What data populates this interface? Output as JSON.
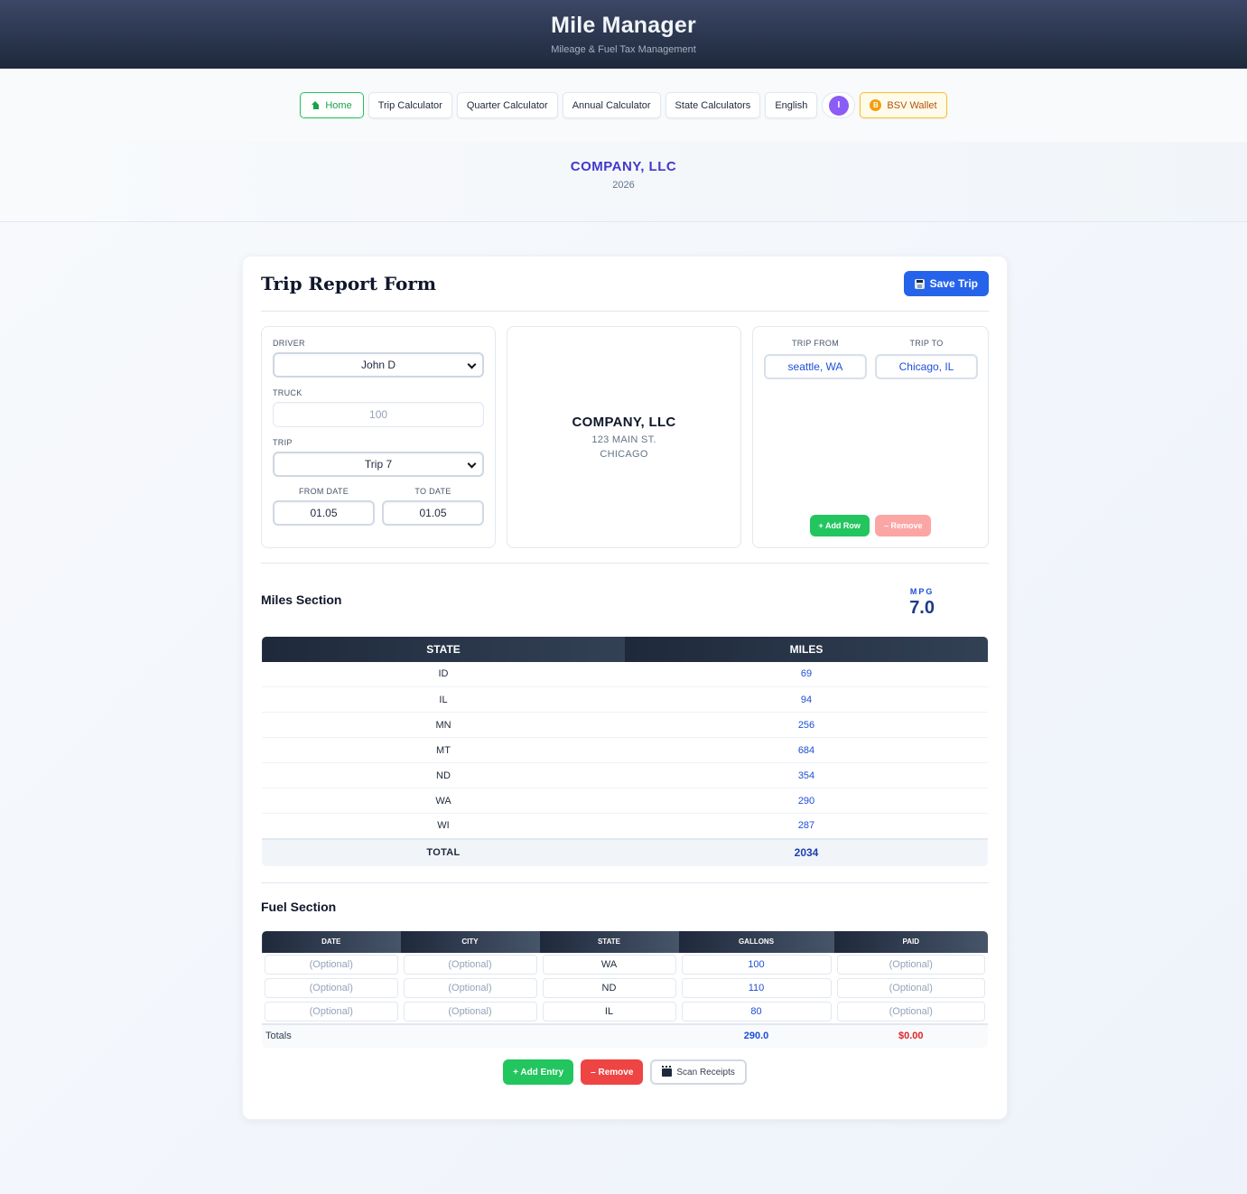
{
  "app": {
    "title": "Mile Manager",
    "subtitle": "Mileage & Fuel Tax Management"
  },
  "nav": {
    "home": "Home",
    "trip_calculator": "Trip Calculator",
    "quarter_calculator": "Quarter Calculator",
    "annual_calculator": "Annual Calculator",
    "state_calculators": "State Calculators",
    "language": "English",
    "avatar_initial": "I",
    "wallet": "BSV Wallet",
    "wallet_coin": "B"
  },
  "banner": {
    "company": "COMPANY, LLC",
    "year": "2026"
  },
  "form": {
    "title": "Trip Report Form",
    "save_label": "Save Trip",
    "driver_label": "DRIVER",
    "driver_value": "John D",
    "truck_label": "TRUCK",
    "truck_placeholder": "100",
    "trip_label": "TRIP",
    "trip_value": "Trip 7",
    "from_date_label": "FROM DATE",
    "from_date_value": "01.05",
    "to_date_label": "TO DATE",
    "to_date_value": "01.05"
  },
  "company_panel": {
    "name": "COMPANY, LLC",
    "address1": "123 MAIN ST.",
    "address2": "CHICAGO"
  },
  "route": {
    "from_label": "TRIP FROM",
    "from_value": "seattle, WA",
    "to_label": "TRIP TO",
    "to_value": "Chicago, IL",
    "add_row": "+ Add Row",
    "remove": "– Remove"
  },
  "miles": {
    "title": "Miles Section",
    "mpg_label": "MPG",
    "mpg_value": "7.0",
    "col_state": "STATE",
    "col_miles": "MILES",
    "rows": [
      {
        "state": "ID",
        "miles": "69"
      },
      {
        "state": "IL",
        "miles": "94"
      },
      {
        "state": "MN",
        "miles": "256"
      },
      {
        "state": "MT",
        "miles": "684"
      },
      {
        "state": "ND",
        "miles": "354"
      },
      {
        "state": "WA",
        "miles": "290"
      },
      {
        "state": "WI",
        "miles": "287"
      }
    ],
    "total_label": "TOTAL",
    "total_value": "2034"
  },
  "fuel": {
    "title": "Fuel Section",
    "columns": [
      "DATE",
      "CITY",
      "STATE",
      "GALLONS",
      "PAID"
    ],
    "optional": "(Optional)",
    "rows": [
      {
        "state": "WA",
        "gallons": "100"
      },
      {
        "state": "ND",
        "gallons": "110"
      },
      {
        "state": "IL",
        "gallons": "80"
      }
    ],
    "totals_label": "Totals",
    "total_gallons": "290.0",
    "total_paid": "$0.00",
    "add_entry": "+ Add Entry",
    "remove": "– Remove",
    "scan_receipts": "Scan Receipts"
  },
  "colors": {
    "accent": "#2563eb",
    "success": "#22c55e",
    "danger": "#ef4444",
    "header": "#1e293b",
    "brand_purple": "#4338ca"
  }
}
